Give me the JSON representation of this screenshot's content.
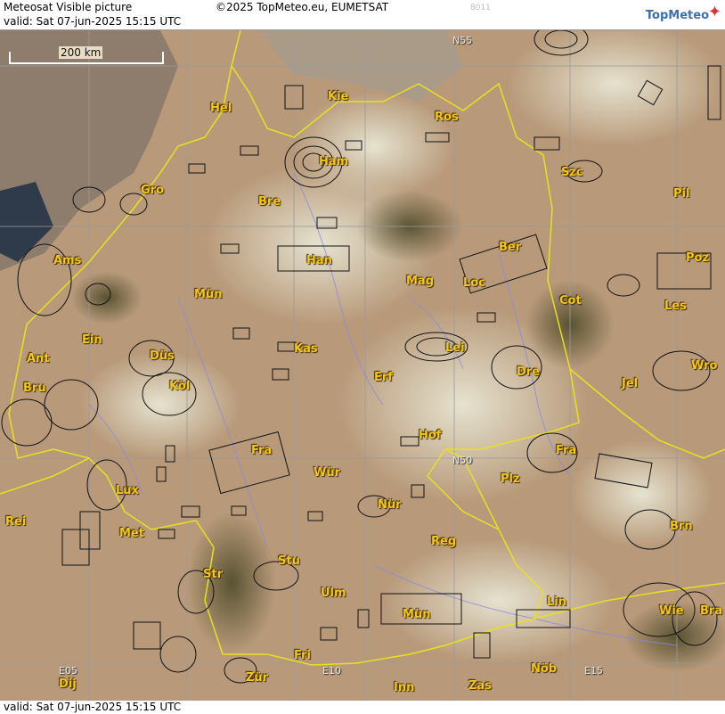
{
  "header": {
    "title": "Meteosat Visible picture",
    "valid_line": "valid:  Sat  07-jun-2025  15:15 UTC",
    "copyright": "©2025 TopMeteo.eu, EUMETSAT",
    "code": "8011",
    "logo_text": "TopMeteo",
    "logo_icon": "compass-star-icon"
  },
  "footer": {
    "valid_line": "valid:  Sat  07-jun-2025  15:15 UTC"
  },
  "scale": {
    "label": "200 km"
  },
  "grid_labels": {
    "n55": "N55",
    "n50": "N50",
    "e05": "E05",
    "e10": "E10",
    "e15": "E15"
  },
  "cities": {
    "hel": "Hel",
    "kie": "Kie",
    "ros": "Ros",
    "ham": "Ham",
    "szc": "Szc",
    "gro": "Gro",
    "bre": "Bre",
    "pil": "Pil",
    "ber": "Ber",
    "ams": "Ams",
    "han": "Han",
    "poz": "Poz",
    "mun_n": "Mün",
    "mag": "Mag",
    "loc": "Loc",
    "cot": "Cot",
    "les": "Les",
    "ein": "Ein",
    "kas": "Kas",
    "lei": "Lei",
    "ant": "Ant",
    "dus": "Düs",
    "dre": "Dre",
    "wro": "Wro",
    "bru": "Bru",
    "kol": "Köl",
    "erf": "Erf",
    "jel": "Jel",
    "hof": "Hof",
    "fra_main": "Fra",
    "fra_cz": "Fra",
    "lux": "Lux",
    "wur": "Wür",
    "plz": "Plz",
    "rei": "Rei",
    "nur": "Nür",
    "met": "Met",
    "brn": "Brn",
    "reg": "Reg",
    "stu": "Stu",
    "str": "Str",
    "lin": "Lin",
    "ulm": "Ulm",
    "mun_s": "Mün",
    "wie": "Wie",
    "bra": "Bra",
    "fri": "Fri",
    "zur": "Zür",
    "nob": "Nöb",
    "dij": "Dij",
    "inn": "Inn",
    "zas": "Zas"
  }
}
